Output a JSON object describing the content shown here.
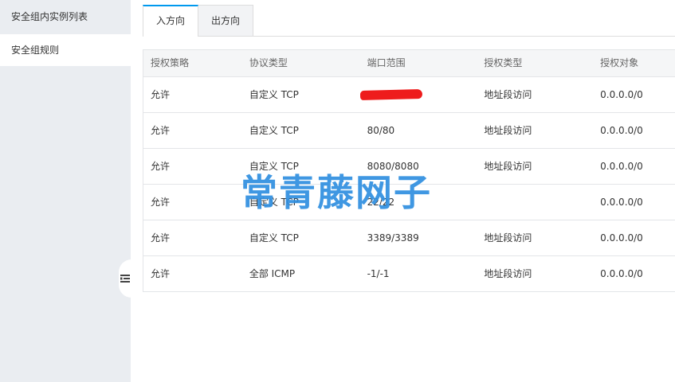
{
  "sidebar": {
    "items": [
      {
        "label": "安全组内实例列表"
      },
      {
        "label": "安全组规则"
      }
    ]
  },
  "tabs": [
    {
      "label": "入方向"
    },
    {
      "label": "出方向"
    }
  ],
  "table": {
    "headers": [
      "授权策略",
      "协议类型",
      "端口范围",
      "授权类型",
      "授权对象"
    ],
    "rows": [
      {
        "policy": "允许",
        "protocol": "自定义 TCP",
        "port": "",
        "auth_type": "地址段访问",
        "target": "0.0.0.0/0"
      },
      {
        "policy": "允许",
        "protocol": "自定义 TCP",
        "port": "80/80",
        "auth_type": "地址段访问",
        "target": "0.0.0.0/0"
      },
      {
        "policy": "允许",
        "protocol": "自定义 TCP",
        "port": "8080/8080",
        "auth_type": "地址段访问",
        "target": "0.0.0.0/0"
      },
      {
        "policy": "允许",
        "protocol": "自定义 TCP",
        "port": "22/22",
        "auth_type": "",
        "target": "0.0.0.0/0"
      },
      {
        "policy": "允许",
        "protocol": "自定义 TCP",
        "port": "3389/3389",
        "auth_type": "地址段访问",
        "target": "0.0.0.0/0"
      },
      {
        "policy": "允许",
        "protocol": "全部 ICMP",
        "port": "-1/-1",
        "auth_type": "地址段访问",
        "target": "0.0.0.0/0"
      }
    ]
  },
  "watermark": {
    "text": "常青藤网子"
  },
  "colors": {
    "accent": "#0099ee",
    "sidebar_bg": "#eaedf1",
    "watermark": "#2f8fe0",
    "redaction": "#ee1c1c"
  },
  "icons": {
    "collapse": "collapse-list-icon"
  }
}
